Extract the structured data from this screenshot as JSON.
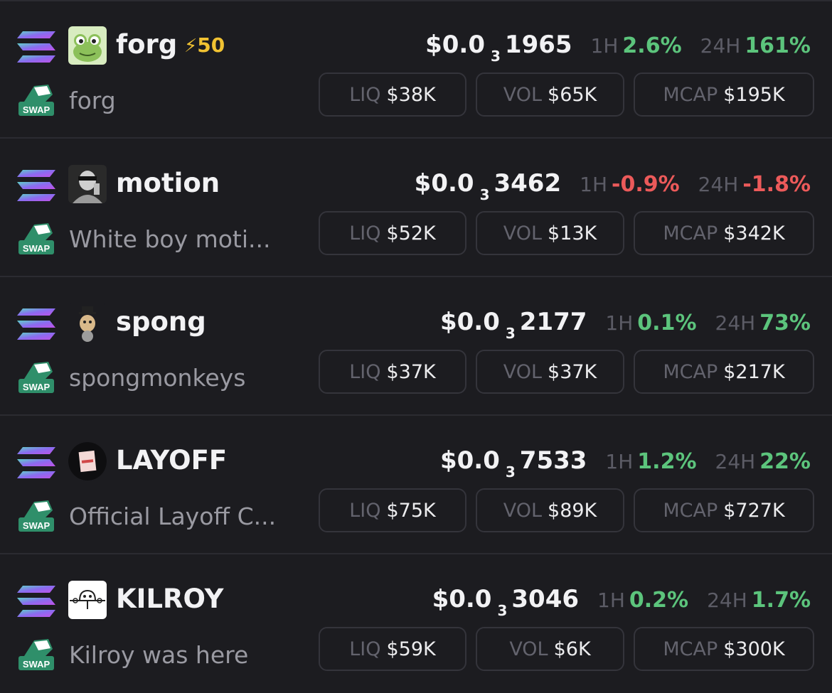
{
  "rows": [
    {
      "ticker": "forg",
      "boost": "50",
      "name": "forg",
      "price_main": "$0.0",
      "price_sub": "3",
      "price_tail": "1965",
      "h1_label": "1H",
      "h1_value": "2.6%",
      "h24_label": "24H",
      "h24_value": "161%",
      "liq_label": "LIQ",
      "liq_value": "$38K",
      "vol_label": "VOL",
      "vol_value": "$65K",
      "mcap_label": "MCAP",
      "mcap_value": "$195K",
      "chain_icon": "solana-icon",
      "avatar_icon": "frog-avatar-icon",
      "swap_icon": "swap-icon"
    },
    {
      "ticker": "motion",
      "name": "White boy moti...",
      "price_main": "$0.0",
      "price_sub": "3",
      "price_tail": "3462",
      "h1_label": "1H",
      "h1_value": "-0.9%",
      "h24_label": "24H",
      "h24_value": "-1.8%",
      "liq_label": "LIQ",
      "liq_value": "$52K",
      "vol_label": "VOL",
      "vol_value": "$13K",
      "mcap_label": "MCAP",
      "mcap_value": "$342K",
      "chain_icon": "solana-icon",
      "avatar_icon": "person-avatar-icon",
      "swap_icon": "swap-icon"
    },
    {
      "ticker": "spong",
      "name": "spongmonkeys",
      "price_main": "$0.0",
      "price_sub": "3",
      "price_tail": "2177",
      "h1_label": "1H",
      "h1_value": "0.1%",
      "h24_label": "24H",
      "h24_value": "73%",
      "liq_label": "LIQ",
      "liq_value": "$37K",
      "vol_label": "VOL",
      "vol_value": "$37K",
      "mcap_label": "MCAP",
      "mcap_value": "$217K",
      "chain_icon": "solana-icon",
      "avatar_icon": "monkey-avatar-icon",
      "swap_icon": "swap-icon"
    },
    {
      "ticker": "LAYOFF",
      "name": "Official Layoff C...",
      "price_main": "$0.0",
      "price_sub": "3",
      "price_tail": "7533",
      "h1_label": "1H",
      "h1_value": "1.2%",
      "h24_label": "24H",
      "h24_value": "22%",
      "liq_label": "LIQ",
      "liq_value": "$75K",
      "vol_label": "VOL",
      "vol_value": "$89K",
      "mcap_label": "MCAP",
      "mcap_value": "$727K",
      "chain_icon": "solana-icon",
      "avatar_icon": "paper-avatar-icon",
      "swap_icon": "swap-icon"
    },
    {
      "ticker": "KILROY",
      "name": "Kilroy was here",
      "price_main": "$0.0",
      "price_sub": "3",
      "price_tail": "3046",
      "h1_label": "1H",
      "h1_value": "0.2%",
      "h24_label": "24H",
      "h24_value": "1.7%",
      "liq_label": "LIQ",
      "liq_value": "$59K",
      "vol_label": "VOL",
      "vol_value": "$6K",
      "mcap_label": "MCAP",
      "mcap_value": "$300K",
      "chain_icon": "solana-icon",
      "avatar_icon": "kilroy-avatar-icon",
      "swap_icon": "swap-icon"
    }
  ],
  "colors": {
    "background": "#1c1c20",
    "positive": "#5cc47c",
    "negative": "#ec5a5a",
    "boost": "#f1c232",
    "swap_green": "#2f8f6a"
  }
}
